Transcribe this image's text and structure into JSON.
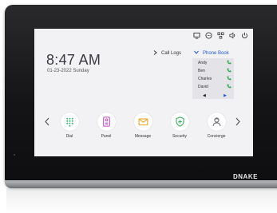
{
  "brand": "DNAKE",
  "status_icons": [
    "monitor-icon",
    "messages-icon",
    "network-icon",
    "volume-icon",
    "power-icon"
  ],
  "clock": {
    "time": "8:47 AM",
    "date": "01-23-2022 Sunday"
  },
  "call_logs": {
    "label": "Call Logs"
  },
  "phone_book": {
    "label": "Phone Book",
    "contacts": [
      {
        "name": "Andy"
      },
      {
        "name": "Ben"
      },
      {
        "name": "Charles"
      },
      {
        "name": "David"
      }
    ],
    "nav": {
      "prev": "◀",
      "next": "▶"
    }
  },
  "apps": [
    {
      "label": "Dial",
      "icon": "dialpad-icon",
      "color": "#35b26b"
    },
    {
      "label": "Panel",
      "icon": "door-panel-icon",
      "color": "#b24fb8"
    },
    {
      "label": "Message",
      "icon": "envelope-icon",
      "color": "#e6a52a"
    },
    {
      "label": "Security",
      "icon": "shield-icon",
      "color": "#3cae60"
    },
    {
      "label": "Concierge",
      "icon": "concierge-icon",
      "color": "#6a6a72"
    }
  ],
  "colors": {
    "accent_blue": "#2255cc",
    "call_green": "#2ea84e"
  }
}
